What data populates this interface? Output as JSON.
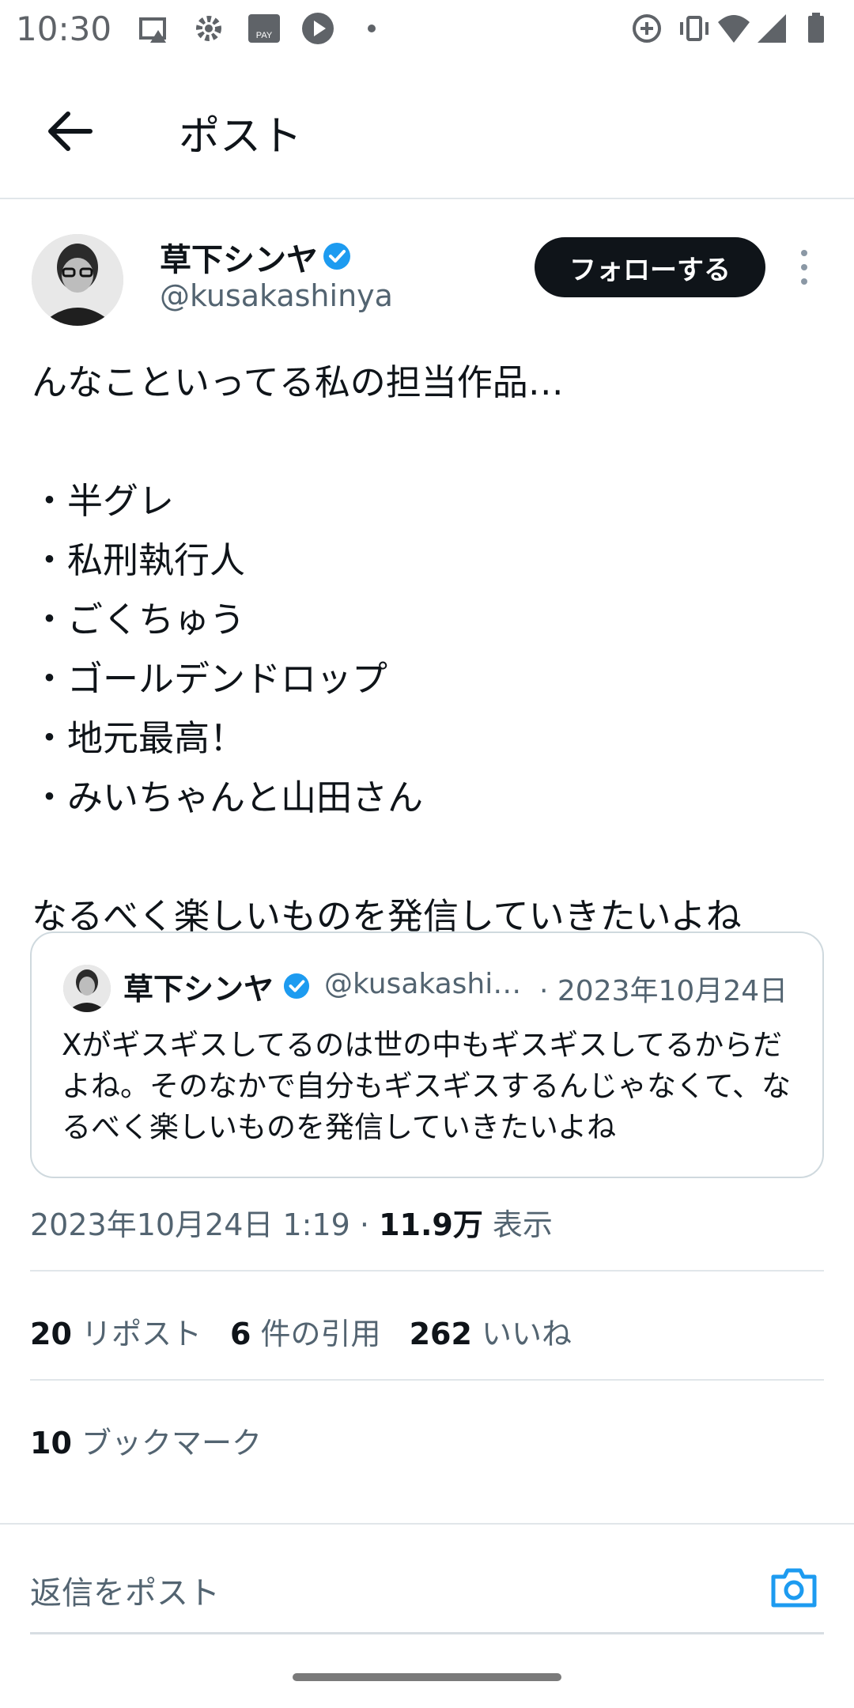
{
  "status_bar": {
    "time": "10:30"
  },
  "header": {
    "title": "ポスト"
  },
  "post": {
    "author_name": "草下シンヤ",
    "author_handle": "@kusakashinya",
    "follow_label": "フォローする",
    "text": "んなこといってる私の担当作品…\n\n・半グレ\n・私刑執行人\n・ごくちゅう\n・ゴールデンドロップ\n・地元最高！\n・みいちゃんと山田さん\n\nなるべく楽しいものを発信していきたいよね",
    "quote": {
      "author_name": "草下シンヤ",
      "author_handle": "@kusakashi…",
      "date": "· 2023年10月24日",
      "text": "Xがギスギスしてるのは世の中もギスギスしてるからだよね。そのなかで自分もギスギスするんじゃなくて、なるべく楽しいものを発信していきたいよね"
    },
    "meta": {
      "timestamp": "2023年10月24日 1:19 · ",
      "views": "11.9万",
      "views_label": " 表示"
    },
    "stats": {
      "reposts": "20",
      "reposts_label": "リポスト",
      "quotes": "6",
      "quotes_label": "件の引用",
      "likes": "262",
      "likes_label": "いいね",
      "bookmarks": "10",
      "bookmarks_label": "ブックマーク"
    }
  },
  "reply": {
    "placeholder": "返信をポスト"
  },
  "colors": {
    "verified": "#1d9bf0",
    "text": "#0f1419",
    "secondary": "#536471",
    "button_bg": "#0f1419"
  }
}
